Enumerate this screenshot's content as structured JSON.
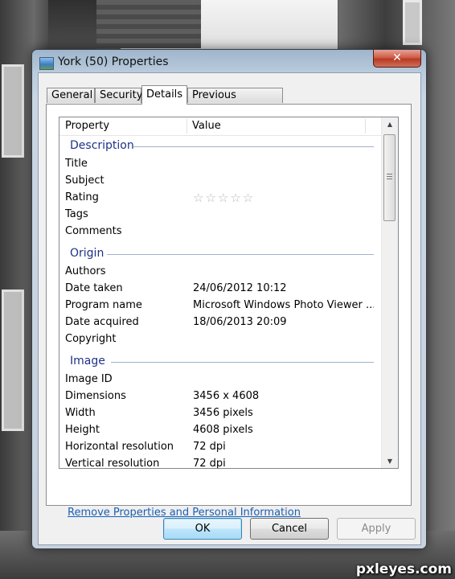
{
  "window": {
    "title": "York (50) Properties",
    "close_label": "✕"
  },
  "tabs": [
    {
      "label": "General"
    },
    {
      "label": "Security"
    },
    {
      "label": "Details"
    },
    {
      "label": "Previous Versions"
    }
  ],
  "list": {
    "col_property": "Property",
    "col_value": "Value",
    "groups": {
      "description": {
        "label": "Description",
        "rows": {
          "title": {
            "name": "Title",
            "value": ""
          },
          "subject": {
            "name": "Subject",
            "value": ""
          },
          "rating": {
            "name": "Rating",
            "value": "☆☆☆☆☆"
          },
          "tags": {
            "name": "Tags",
            "value": ""
          },
          "comments": {
            "name": "Comments",
            "value": ""
          }
        }
      },
      "origin": {
        "label": "Origin",
        "rows": {
          "authors": {
            "name": "Authors",
            "value": ""
          },
          "date_taken": {
            "name": "Date taken",
            "value": "24/06/2012 10:12"
          },
          "program_name": {
            "name": "Program name",
            "value": "Microsoft Windows Photo Viewer ..."
          },
          "date_acquired": {
            "name": "Date acquired",
            "value": "18/06/2013 20:09"
          },
          "copyright": {
            "name": "Copyright",
            "value": ""
          }
        }
      },
      "image": {
        "label": "Image",
        "rows": {
          "image_id": {
            "name": "Image ID",
            "value": ""
          },
          "dimensions": {
            "name": "Dimensions",
            "value": "3456 x 4608"
          },
          "width": {
            "name": "Width",
            "value": "3456 pixels"
          },
          "height": {
            "name": "Height",
            "value": "4608 pixels"
          },
          "horizontal_resolution": {
            "name": "Horizontal resolution",
            "value": "72 dpi"
          },
          "vertical_resolution": {
            "name": "Vertical resolution",
            "value": "72 dpi"
          }
        }
      }
    }
  },
  "link": {
    "remove_properties": "Remove Properties and Personal Information"
  },
  "buttons": {
    "ok": "OK",
    "cancel": "Cancel",
    "apply": "Apply"
  },
  "watermark": "pxleyes.com",
  "icons": {
    "window": "image-file-icon",
    "close": "close-icon",
    "scroll_up": "scroll-up-arrow-icon",
    "scroll_down": "scroll-down-arrow-icon"
  },
  "colors": {
    "group_header": "#1e3287",
    "link": "#1a5fb4",
    "close_button": "#c24a35"
  }
}
